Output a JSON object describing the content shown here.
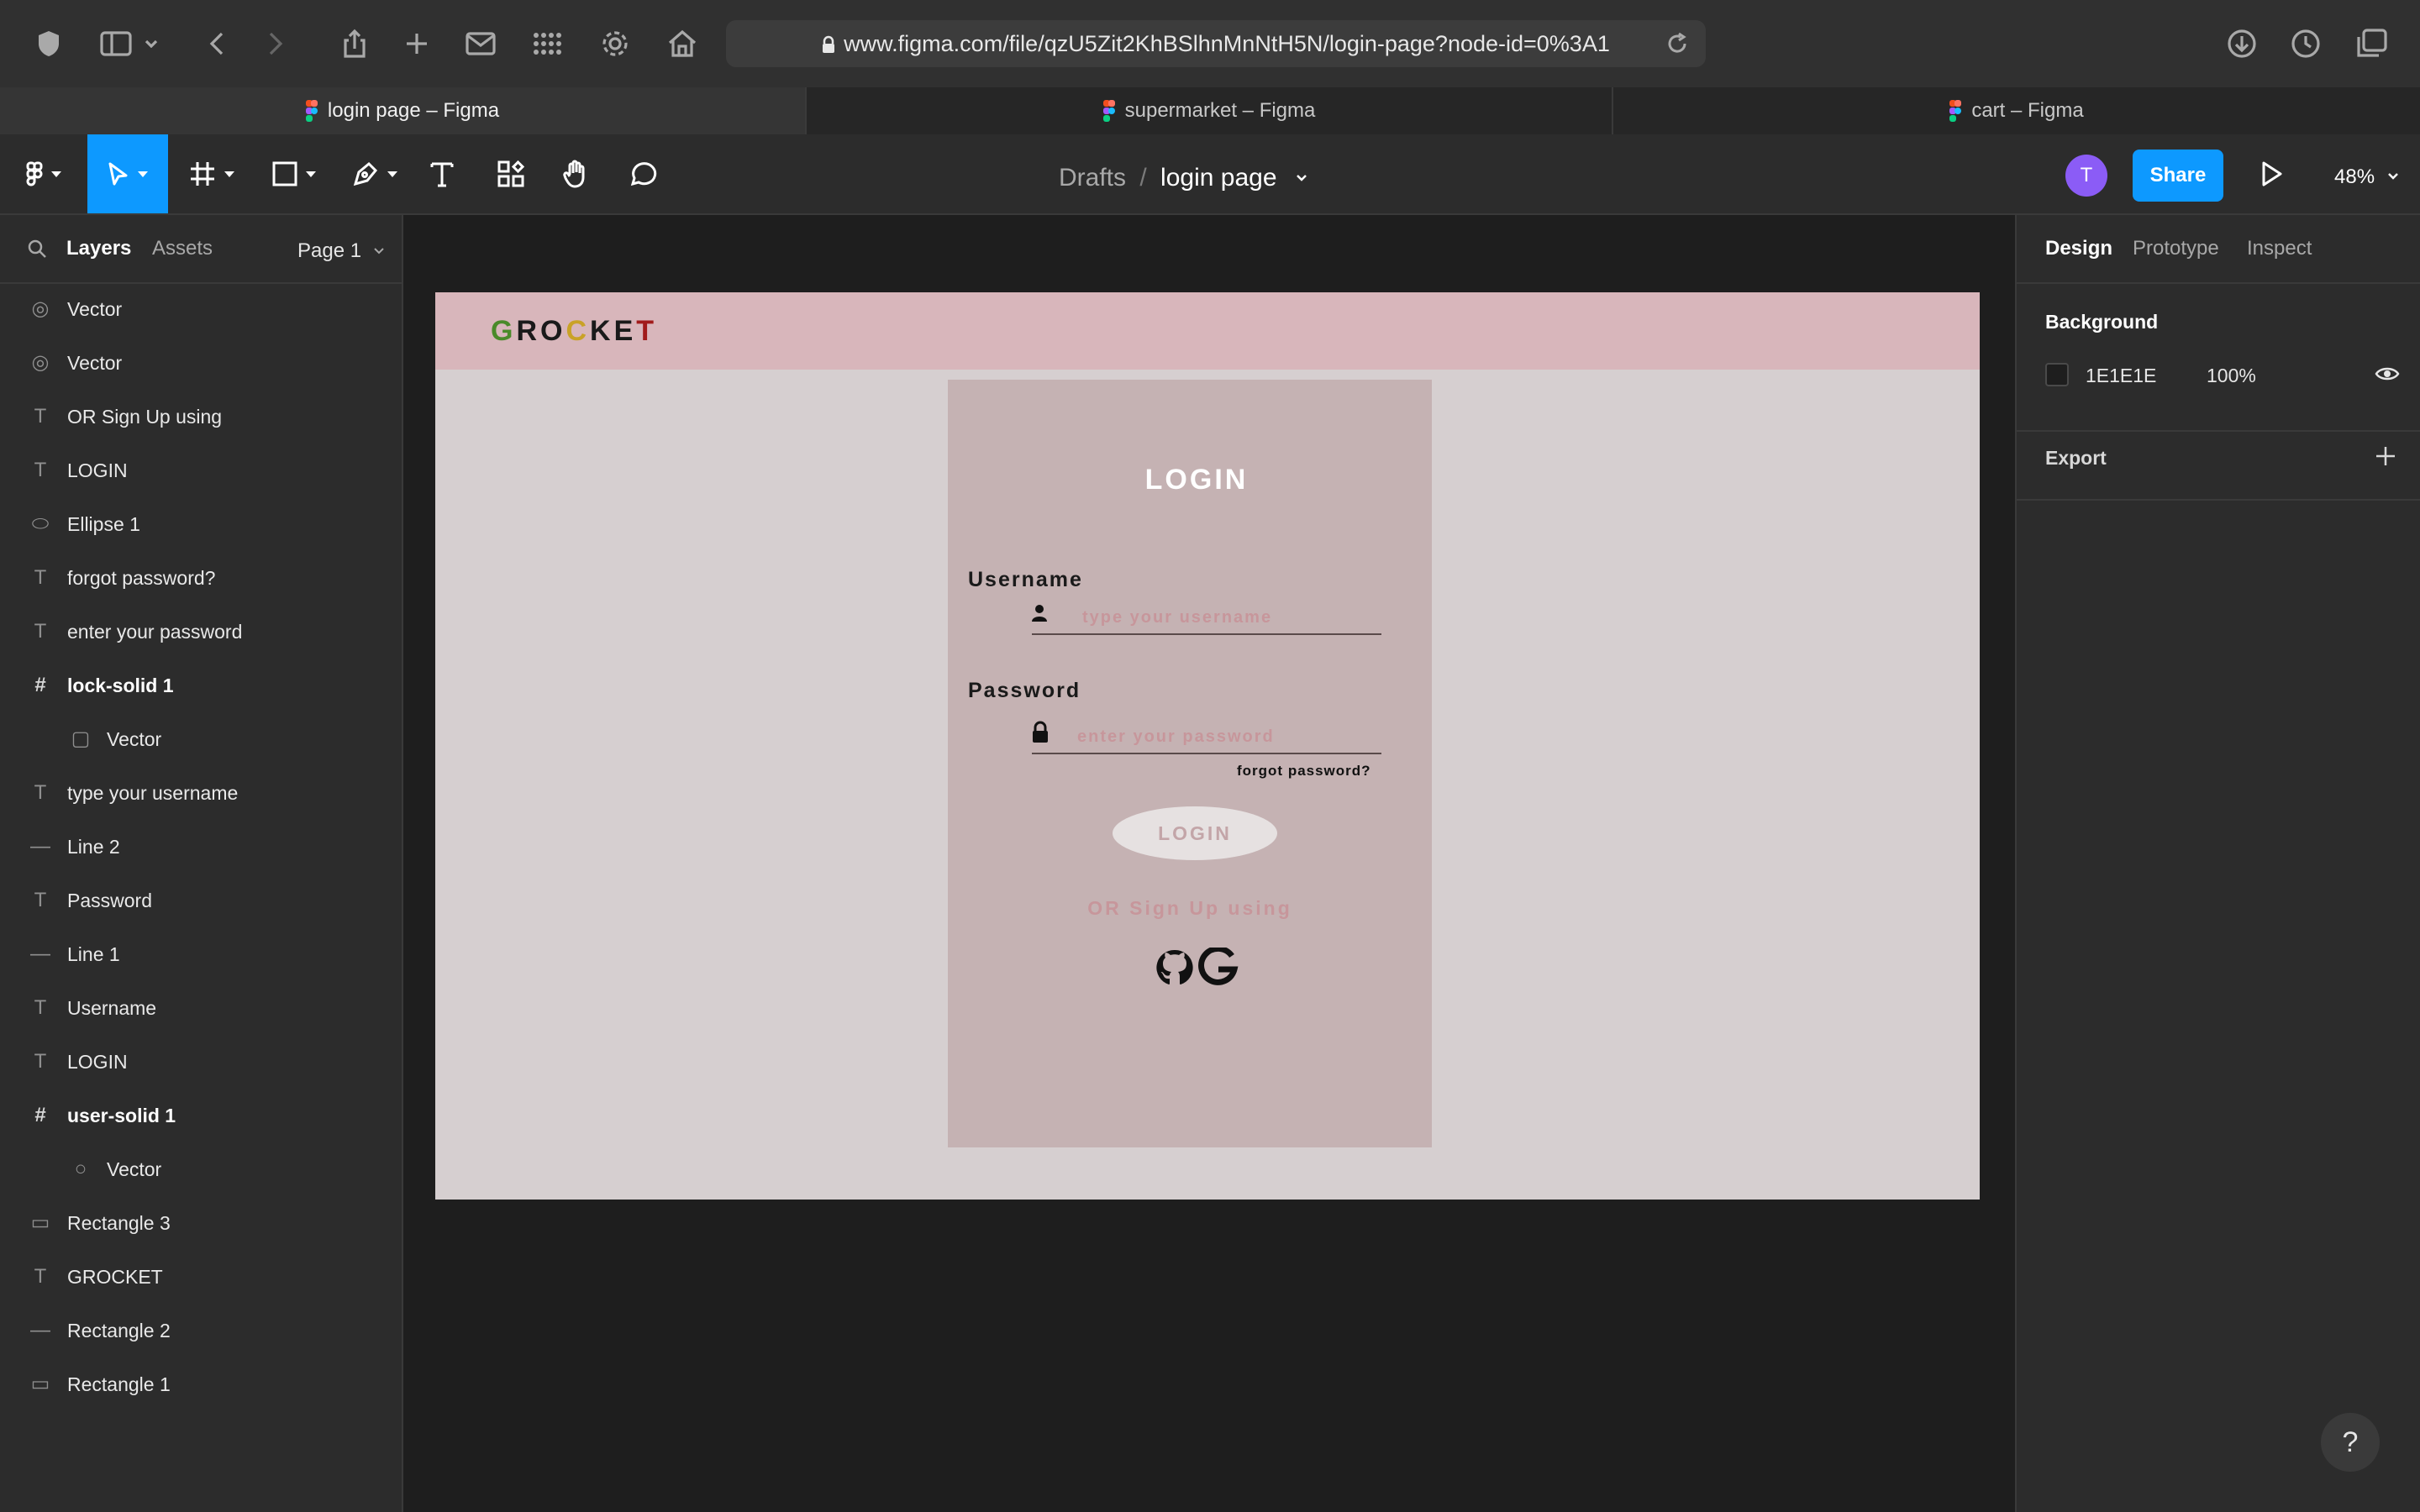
{
  "browser": {
    "url": "www.figma.com/file/qzU5Zit2KhBSlhnMnNtH5N/login-page?node-id=0%3A1",
    "tabs": [
      {
        "title": "login page – Figma"
      },
      {
        "title": "supermarket – Figma"
      },
      {
        "title": "cart – Figma"
      }
    ]
  },
  "toolbar": {
    "breadcrumb_parent": "Drafts",
    "breadcrumb_sep": "/",
    "file_name": "login page",
    "avatar_initial": "T",
    "share_label": "Share",
    "zoom": "48%"
  },
  "left_panel": {
    "tab_layers": "Layers",
    "tab_assets": "Assets",
    "page": "Page 1",
    "layers": [
      {
        "name": "Vector",
        "icon": "vector-icon"
      },
      {
        "name": "Vector",
        "icon": "vector-icon"
      },
      {
        "name": "OR Sign Up using",
        "icon": "text-icon"
      },
      {
        "name": "LOGIN",
        "icon": "text-icon"
      },
      {
        "name": "Ellipse 1",
        "icon": "ellipse-icon"
      },
      {
        "name": "forgot password?",
        "icon": "text-icon"
      },
      {
        "name": "enter your password",
        "icon": "text-icon"
      },
      {
        "name": "lock-solid 1",
        "icon": "frame-icon"
      },
      {
        "name": "Vector",
        "icon": "lock-icon"
      },
      {
        "name": "type your username",
        "icon": "text-icon"
      },
      {
        "name": "Line 2",
        "icon": "line-icon"
      },
      {
        "name": "Password",
        "icon": "text-icon"
      },
      {
        "name": "Line 1",
        "icon": "line-icon"
      },
      {
        "name": "Username",
        "icon": "text-icon"
      },
      {
        "name": "LOGIN",
        "icon": "text-icon"
      },
      {
        "name": "user-solid 1",
        "icon": "frame-icon"
      },
      {
        "name": "Vector",
        "icon": "user-icon"
      },
      {
        "name": "Rectangle 3",
        "icon": "rectangle-icon"
      },
      {
        "name": "GROCKET",
        "icon": "text-icon"
      },
      {
        "name": "Rectangle 2",
        "icon": "line-icon"
      },
      {
        "name": "Rectangle 1",
        "icon": "rectangle-icon"
      }
    ]
  },
  "right_panel": {
    "tab_design": "Design",
    "tab_prototype": "Prototype",
    "tab_inspect": "Inspect",
    "background_label": "Background",
    "background_hex": "1E1E1E",
    "background_opacity": "100%",
    "export_label": "Export"
  },
  "canvas": {
    "logo_letters": [
      {
        "ch": "G",
        "color": "#4a8a2a"
      },
      {
        "ch": "R",
        "color": "#1a1a1a"
      },
      {
        "ch": "O",
        "color": "#1a1a1a"
      },
      {
        "ch": "C",
        "color": "#c9a227"
      },
      {
        "ch": "K",
        "color": "#1a1a1a"
      },
      {
        "ch": "E",
        "color": "#1a1a1a"
      },
      {
        "ch": "T",
        "color": "#a11b1b"
      }
    ],
    "login_title": "LOGIN",
    "username_label": "Username",
    "username_placeholder": "type your username",
    "password_label": "Password",
    "password_placeholder": "enter your password",
    "forgot": "forgot password?",
    "login_button": "LOGIN",
    "or_signup": "OR Sign Up using"
  },
  "colors": {
    "figma_accent": "#0d99ff",
    "frame_bg": "#d6cfd0",
    "header_bg": "#d8b6bb",
    "card_bg": "#c5b2b3"
  },
  "help": "?"
}
